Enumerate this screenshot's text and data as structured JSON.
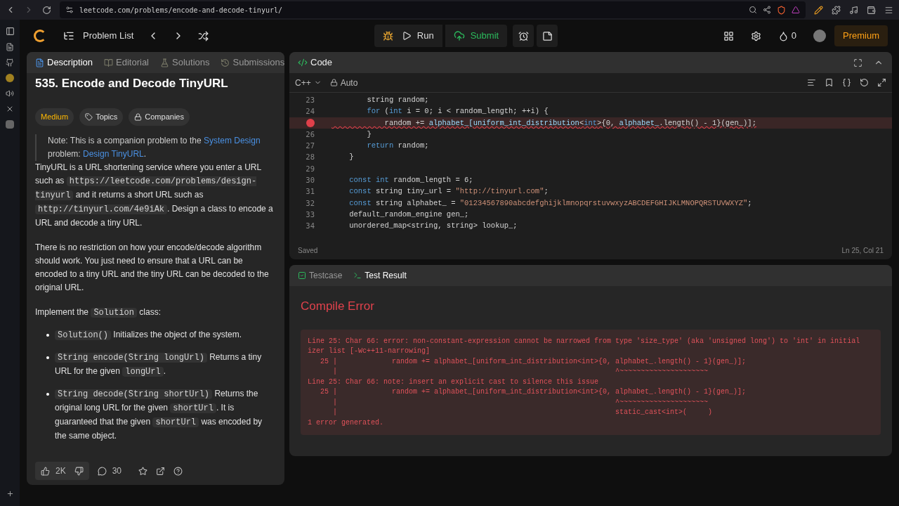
{
  "browser": {
    "url": "leetcode.com/problems/encode-and-decode-tinyurl/"
  },
  "header": {
    "problem_list": "Problem List",
    "run": "Run",
    "submit": "Submit",
    "streak": "0",
    "premium": "Premium"
  },
  "left_tabs": [
    {
      "label": "Description",
      "selected": true
    },
    {
      "label": "Editorial",
      "selected": false
    },
    {
      "label": "Solutions",
      "selected": false
    },
    {
      "label": "Submissions",
      "selected": false
    }
  ],
  "problem": {
    "title": "535. Encode and Decode TinyURL",
    "difficulty": "Medium",
    "topics": "Topics",
    "companies": "Companies",
    "note": [
      {
        "t": "Note: This is a companion problem to the "
      },
      {
        "t": "System Design",
        "link": true
      },
      {
        "t": " problem: "
      },
      {
        "t": "Design TinyURL",
        "link": true
      },
      {
        "t": "."
      }
    ],
    "paragraphs": [
      [
        {
          "t": "TinyURL is a URL shortening service where you enter a URL such as "
        },
        {
          "t": "https://leetcode.com/problems/design-tinyurl",
          "code": true
        },
        {
          "t": " and it returns a short URL such as "
        },
        {
          "t": "http://tinyurl.com/4e9iAk",
          "code": true
        },
        {
          "t": ". Design a class to encode a URL and decode a tiny URL."
        }
      ],
      [
        {
          "t": "There is no restriction on how your encode/decode algorithm should work. You just need to ensure that a URL can be encoded to a tiny URL and the tiny URL can be decoded to the original URL."
        }
      ],
      [
        {
          "t": "Implement the "
        },
        {
          "t": "Solution",
          "code": true
        },
        {
          "t": " class:"
        }
      ]
    ],
    "bullets": [
      [
        {
          "t": "Solution()",
          "code": true
        },
        {
          "t": " Initializes the object of the system."
        }
      ],
      [
        {
          "t": "String encode(String longUrl)",
          "code": true
        },
        {
          "t": " Returns a tiny URL for the given "
        },
        {
          "t": "longUrl",
          "code": true
        },
        {
          "t": "."
        }
      ],
      [
        {
          "t": "String decode(String shortUrl)",
          "code": true
        },
        {
          "t": " Returns the original long URL for the given "
        },
        {
          "t": "shortUrl",
          "code": true
        },
        {
          "t": ". It is guaranteed that the given "
        },
        {
          "t": "shortUrl",
          "code": true
        },
        {
          "t": " was encoded by the same object."
        }
      ]
    ]
  },
  "footer": {
    "likes": "2K",
    "comments": "30"
  },
  "code_panel": {
    "title": "Code",
    "language": "C++",
    "mode": "Auto",
    "status": "Saved",
    "cursor": "Ln 25, Col 21",
    "lines": [
      {
        "n": "23",
        "error": false,
        "segs": [
          {
            "t": "        string random;"
          }
        ]
      },
      {
        "n": "24",
        "error": false,
        "segs": [
          {
            "t": "        for",
            "kind": "keyword"
          },
          {
            "t": " ("
          },
          {
            "t": "int",
            "kind": "keyword"
          },
          {
            "t": " i = 0; i < random_length; ++i) {"
          }
        ]
      },
      {
        "error": true,
        "segs": [
          {
            "t": "            random += "
          },
          {
            "t": "alphabet_[uniform_int_distribution",
            "kind": "identifier"
          },
          {
            "t": "<"
          },
          {
            "t": "int",
            "kind": "keyword"
          },
          {
            "t": ">{0, "
          },
          {
            "t": "alphabet_",
            "kind": "identifier"
          },
          {
            "t": ".length() - 1}(gen_)];"
          }
        ]
      },
      {
        "n": "26",
        "error": false,
        "segs": [
          {
            "t": "        }"
          }
        ]
      },
      {
        "n": "27",
        "error": false,
        "segs": [
          {
            "t": "        return",
            "kind": "keyword"
          },
          {
            "t": " random;"
          }
        ]
      },
      {
        "n": "28",
        "error": false,
        "segs": [
          {
            "t": "    }"
          }
        ]
      },
      {
        "n": "29",
        "error": false
      },
      {
        "n": "30",
        "error": false,
        "segs": [
          {
            "t": "    const int",
            "kind": "keyword"
          },
          {
            "t": " random_length = 6;"
          }
        ]
      },
      {
        "n": "31",
        "error": false,
        "segs": [
          {
            "t": "    const",
            "kind": "keyword"
          },
          {
            "t": " string tiny_url = "
          },
          {
            "t": "\"http://tinyurl.com\"",
            "kind": "string"
          },
          {
            "t": ";"
          }
        ]
      },
      {
        "n": "32",
        "error": false,
        "segs": [
          {
            "t": "    const",
            "kind": "keyword"
          },
          {
            "t": " string alphabet_ = "
          },
          {
            "t": "\"01234567890abcdefghijklmnopqrstuvwxyzABCDEFGHIJKLMNOPQRSTUVWXYZ\"",
            "kind": "string"
          },
          {
            "t": ";"
          }
        ]
      },
      {
        "n": "33",
        "error": false,
        "segs": [
          {
            "t": "    default_random_engine gen_;"
          }
        ]
      },
      {
        "n": "34",
        "error": false,
        "segs": [
          {
            "t": "    unordered_map<string, string> lookup_;"
          }
        ]
      }
    ]
  },
  "result_tabs": [
    {
      "label": "Testcase",
      "selected": false
    },
    {
      "label": "Test Result",
      "selected": true
    }
  ],
  "result": {
    "heading": "Compile Error",
    "output": "Line 25: Char 66: error: non-constant-expression cannot be narrowed from type 'size_type' (aka 'unsigned long') to 'int' in initial\nizer list [-Wc++11-narrowing]\n   25 |             random += alphabet_[uniform_int_distribution<int>{0, alphabet_.length() - 1}(gen_)];\n      |                                                                  ^~~~~~~~~~~~~~~~~~~~~~\nLine 25: Char 66: note: insert an explicit cast to silence this issue\n   25 |             random += alphabet_[uniform_int_distribution<int>{0, alphabet_.length() - 1}(gen_)];\n      |                                                                  ^~~~~~~~~~~~~~~~~~~~~~\n      |                                                                  static_cast<int>(     )\n1 error generated."
  }
}
